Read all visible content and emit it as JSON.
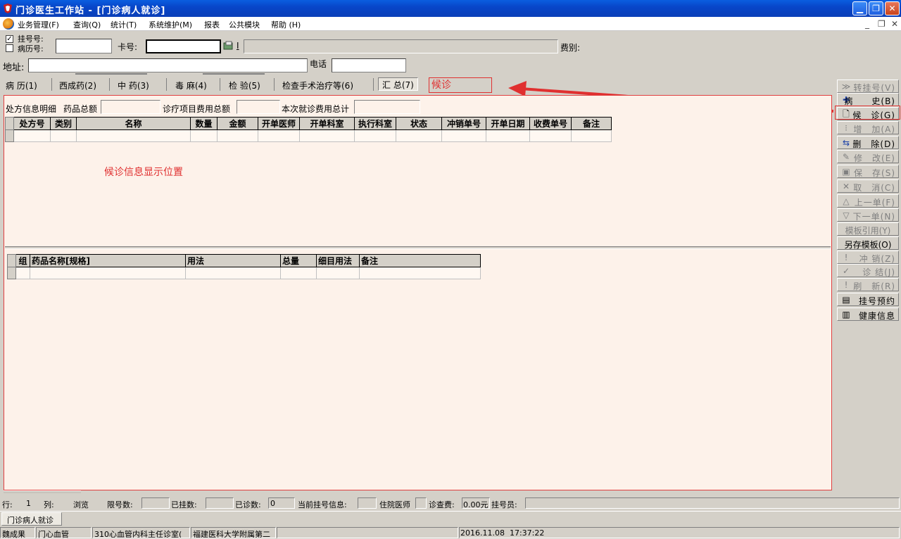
{
  "window": {
    "title": "门诊医生工作站 - [门诊病人就诊]",
    "minimize": "▁",
    "restore": "❐",
    "close": "✕"
  },
  "menu": {
    "items": [
      "业务管理(F)",
      "查询(Q)",
      "统计(T)",
      "系统维护(M)",
      "报表",
      "公共模块",
      "帮助 (H)"
    ],
    "mdi_min": "_",
    "mdi_restore": "❐",
    "mdi_close": "✕"
  },
  "query": {
    "reg_no_label": "挂号号:",
    "record_no_label": "病历号:",
    "reg_checked": "✓",
    "card_label": "卡号:",
    "card_button": "I",
    "fee_label": "费别:",
    "address_label": "地址:",
    "phone_label": "电话"
  },
  "tabs": [
    "病 历(1)",
    "西成药(2)",
    "中 药(3)",
    "毒 麻(4)",
    "检 验(5)",
    "检查手术治疗等(6)",
    "汇 总(7)"
  ],
  "tab_underline": [
    "1",
    "2",
    "3",
    "4",
    "5",
    "6",
    "7"
  ],
  "annotation": {
    "waiting_label": "候诊",
    "waiting_info": "候诊信息显示位置",
    "color": "#e03030"
  },
  "summary": {
    "detail_label": "处方信息明细",
    "drug_total_label": "药品总额",
    "item_total_label": "诊疗项目费用总额",
    "visit_total_label": "本次就诊费用总计"
  },
  "prescription_table": {
    "columns": [
      "处方号",
      "类别",
      "名称",
      "数量",
      "金额",
      "开单医师",
      "开单科室",
      "执行科室",
      "状态",
      "冲销单号",
      "开单日期",
      "收费单号",
      "备注"
    ]
  },
  "drug_table": {
    "columns": [
      "组",
      "药品名称[规格]",
      "用法",
      "总量",
      "细目用法",
      "备注"
    ]
  },
  "toolbar": {
    "buttons": [
      {
        "label": "转挂号(V)",
        "icon": "≫",
        "enabled": false
      },
      {
        "label": "病　　史(B)",
        "icon": "✚",
        "enabled": true
      },
      {
        "label": "候　诊(G)",
        "icon": "🗋",
        "enabled": true
      },
      {
        "label": "增　加(A)",
        "icon": "⁝",
        "enabled": false
      },
      {
        "label": "删　除(D)",
        "icon": "⇆",
        "enabled": true
      },
      {
        "label": "修　改(E)",
        "icon": "✎",
        "enabled": false
      },
      {
        "label": "保　存(S)",
        "icon": "▣",
        "enabled": false
      },
      {
        "label": "取　消(C)",
        "icon": "✕",
        "enabled": false
      },
      {
        "label": "上一单(F)",
        "icon": "△",
        "enabled": false
      },
      {
        "label": "下一单(N)",
        "icon": "▽",
        "enabled": false
      },
      {
        "label": "模板引用(Y)",
        "icon": "",
        "enabled": false
      },
      {
        "label": "另存模板(O)",
        "icon": "",
        "enabled": true
      },
      {
        "label": "冲 销(Z)",
        "icon": "!",
        "enabled": false
      },
      {
        "label": "诊 结(J)",
        "icon": "✓",
        "enabled": false
      },
      {
        "label": "刷　新(R)",
        "icon": "!",
        "enabled": false
      },
      {
        "label": "挂号预约",
        "icon": "▤",
        "enabled": true
      },
      {
        "label": "健康信息",
        "icon": "▥",
        "enabled": true
      }
    ]
  },
  "status1": {
    "row_label": "行:",
    "row_value": "1",
    "col_label": "列:",
    "mode": "浏览",
    "limit_label": "限号数:",
    "registered_label": "已挂数:",
    "seen_label": "已诊数:",
    "seen_value": "0",
    "current_reg_label": "当前挂号信息:",
    "inpatient_doctor": "住院医师",
    "fee_label": "诊查费:",
    "fee_value": "0.00元",
    "registrar_label": "挂号员:"
  },
  "taskbar": {
    "window_tab": "门诊病人就诊"
  },
  "status2": {
    "user": "魏成果",
    "dept": "门心血管",
    "room": "310心血管内科主任诊室(",
    "hospital": "福建医科大学附属第二",
    "datetime": "2016.11.08  17:37:22"
  }
}
